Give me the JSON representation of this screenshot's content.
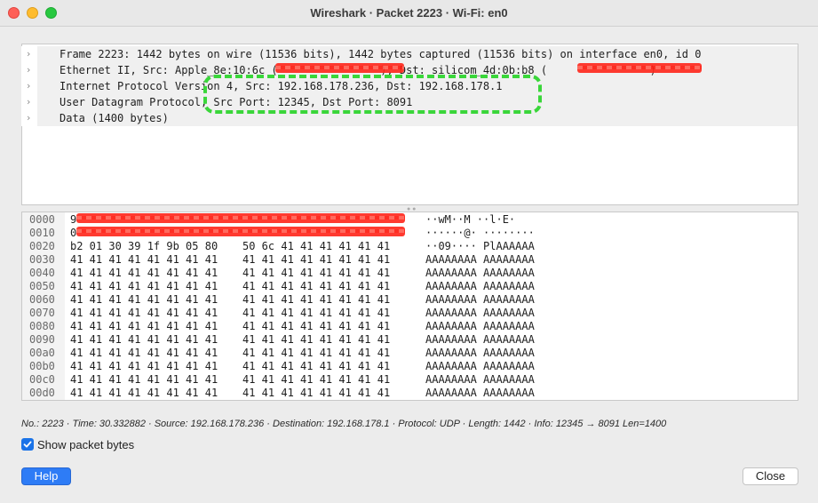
{
  "window": {
    "title": "Wireshark · Packet 2223 · Wi-Fi: en0"
  },
  "tree": {
    "rows": [
      "Frame 2223: 1442 bytes on wire (11536 bits), 1442 bytes captured (11536 bits) on interface en0, id 0",
      "Ethernet II, Src: Apple_8e:10:6c (                ), Dst: silicom_4d:0b:b8 (                )",
      "Internet Protocol Version 4, Src: 192.168.178.236, Dst: 192.168.178.1",
      "User Datagram Protocol, Src Port: 12345, Dst Port: 8091",
      "Data (1400 bytes)"
    ]
  },
  "hex": {
    "rows": [
      {
        "offset": "0000",
        "b1": "9",
        "b2": "",
        "ascii": "··wM··M ··l·E·"
      },
      {
        "offset": "0010",
        "b1": "0",
        "b2": "",
        "ascii": "······@· ········"
      },
      {
        "offset": "0020",
        "b1": "b2 01 30 39 1f 9b 05 80",
        "b2": "50 6c 41 41 41 41 41 41",
        "ascii": "··09···· PlAAAAAA"
      },
      {
        "offset": "0030",
        "b1": "41 41 41 41 41 41 41 41",
        "b2": "41 41 41 41 41 41 41 41",
        "ascii": "AAAAAAAA AAAAAAAA"
      },
      {
        "offset": "0040",
        "b1": "41 41 41 41 41 41 41 41",
        "b2": "41 41 41 41 41 41 41 41",
        "ascii": "AAAAAAAA AAAAAAAA"
      },
      {
        "offset": "0050",
        "b1": "41 41 41 41 41 41 41 41",
        "b2": "41 41 41 41 41 41 41 41",
        "ascii": "AAAAAAAA AAAAAAAA"
      },
      {
        "offset": "0060",
        "b1": "41 41 41 41 41 41 41 41",
        "b2": "41 41 41 41 41 41 41 41",
        "ascii": "AAAAAAAA AAAAAAAA"
      },
      {
        "offset": "0070",
        "b1": "41 41 41 41 41 41 41 41",
        "b2": "41 41 41 41 41 41 41 41",
        "ascii": "AAAAAAAA AAAAAAAA"
      },
      {
        "offset": "0080",
        "b1": "41 41 41 41 41 41 41 41",
        "b2": "41 41 41 41 41 41 41 41",
        "ascii": "AAAAAAAA AAAAAAAA"
      },
      {
        "offset": "0090",
        "b1": "41 41 41 41 41 41 41 41",
        "b2": "41 41 41 41 41 41 41 41",
        "ascii": "AAAAAAAA AAAAAAAA"
      },
      {
        "offset": "00a0",
        "b1": "41 41 41 41 41 41 41 41",
        "b2": "41 41 41 41 41 41 41 41",
        "ascii": "AAAAAAAA AAAAAAAA"
      },
      {
        "offset": "00b0",
        "b1": "41 41 41 41 41 41 41 41",
        "b2": "41 41 41 41 41 41 41 41",
        "ascii": "AAAAAAAA AAAAAAAA"
      },
      {
        "offset": "00c0",
        "b1": "41 41 41 41 41 41 41 41",
        "b2": "41 41 41 41 41 41 41 41",
        "ascii": "AAAAAAAA AAAAAAAA"
      },
      {
        "offset": "00d0",
        "b1": "41 41 41 41 41 41 41 41",
        "b2": "41 41 41 41 41 41 41 41",
        "ascii": "AAAAAAAA AAAAAAAA"
      }
    ]
  },
  "status": {
    "text": "No.: 2223 · Time: 30.332882 · Source: 192.168.178.236 · Destination: 192.168.178.1 · Protocol: UDP · Length: 1442 · Info: 12345 → 8091 Len=1400"
  },
  "options": {
    "show_packet_bytes_label": "Show packet bytes",
    "show_packet_bytes_checked": true
  },
  "buttons": {
    "help_label": "Help",
    "close_label": "Close"
  },
  "colors": {
    "accent": "#2e7cf6",
    "redaction": "#ff2a1f",
    "highlight": "#3ad63a"
  },
  "icons": {
    "expand": "chevron-right-icon",
    "checkbox": "checkmark-icon"
  }
}
